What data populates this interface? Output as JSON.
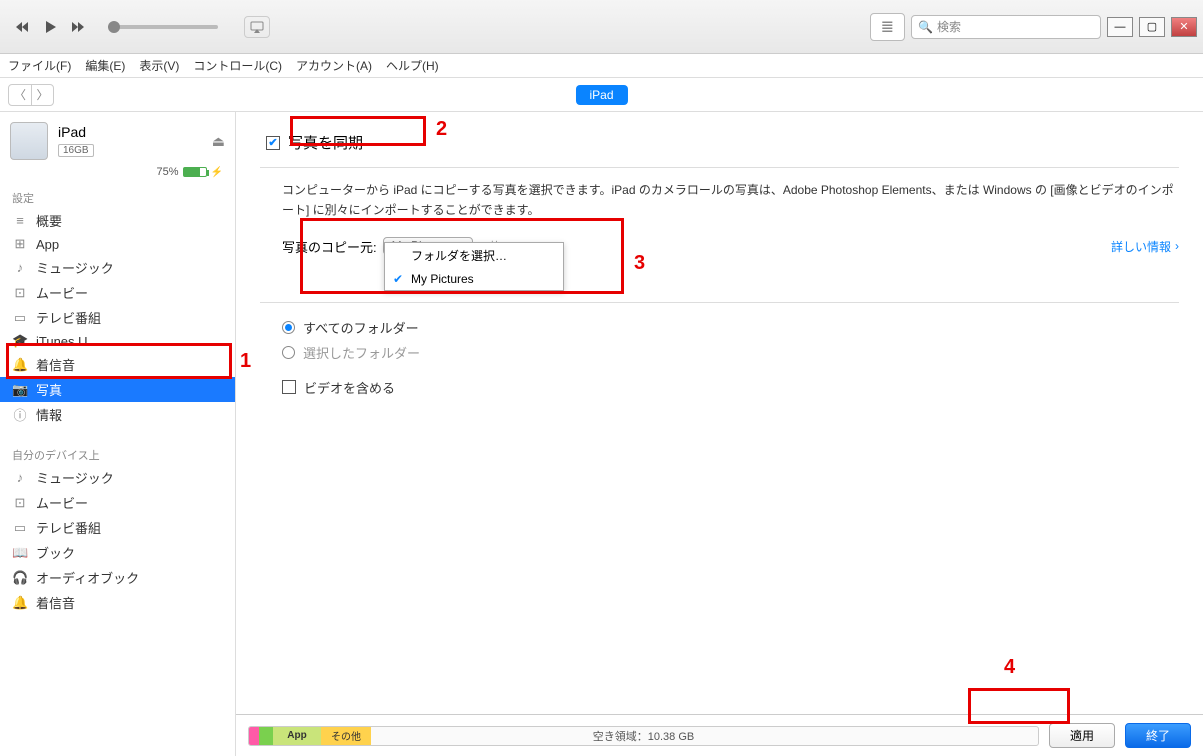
{
  "titlebar": {
    "search_placeholder": "検索"
  },
  "menubar": {
    "items": [
      "ファイル(F)",
      "編集(E)",
      "表示(V)",
      "コントロール(C)",
      "アカウント(A)",
      "ヘルプ(H)"
    ]
  },
  "pill": "iPad",
  "device": {
    "name": "iPad",
    "capacity": "16GB",
    "battery_pct": "75%"
  },
  "sidebar": {
    "section1_label": "設定",
    "items1": [
      {
        "icon": "≡",
        "label": "概要",
        "name": "summary"
      },
      {
        "icon": "⊞",
        "label": "App",
        "name": "app"
      },
      {
        "icon": "♪",
        "label": "ミュージック",
        "name": "music"
      },
      {
        "icon": "⊡",
        "label": "ムービー",
        "name": "movies"
      },
      {
        "icon": "▭",
        "label": "テレビ番組",
        "name": "tv"
      },
      {
        "icon": "🎓",
        "label": "iTunes U",
        "name": "itunesu"
      },
      {
        "icon": "🔔",
        "label": "着信音",
        "name": "ringtones"
      },
      {
        "icon": "📷",
        "label": "写真",
        "name": "photos",
        "selected": true
      },
      {
        "icon": "ⓘ",
        "label": "情報",
        "name": "info"
      }
    ],
    "section2_label": "自分のデバイス上",
    "items2": [
      {
        "icon": "♪",
        "label": "ミュージック",
        "name": "dev-music"
      },
      {
        "icon": "⊡",
        "label": "ムービー",
        "name": "dev-movies"
      },
      {
        "icon": "▭",
        "label": "テレビ番組",
        "name": "dev-tv"
      },
      {
        "icon": "📖",
        "label": "ブック",
        "name": "dev-books"
      },
      {
        "icon": "🎧",
        "label": "オーディオブック",
        "name": "dev-audiobooks"
      },
      {
        "icon": "🔔",
        "label": "着信音",
        "name": "dev-ringtones"
      }
    ]
  },
  "content": {
    "sync_label": "写真を同期",
    "desc": "コンピューターから iPad にコピーする写真を選択できます。iPad のカメラロールの写真は、Adobe Photoshop Elements、または Windows の [画像とビデオのインポート] に別々にインポートすることができます。",
    "source_label": "写真のコピー元:",
    "source_value": "My Pictures",
    "count": "0 枚",
    "more_link": "詳しい情報",
    "dropdown": {
      "opt1": "フォルダを選択…",
      "opt2": "My Pictures"
    },
    "radio_all": "すべてのフォルダー",
    "radio_selected": "選択したフォルダー",
    "chk_video": "ビデオを含める"
  },
  "footer": {
    "seg_app": "App",
    "seg_other": "その他",
    "free_label": "空き領域：10.38 GB",
    "apply": "適用",
    "done": "終了"
  },
  "annotations": {
    "l1": "1",
    "l2": "2",
    "l3": "3",
    "l4": "4"
  }
}
